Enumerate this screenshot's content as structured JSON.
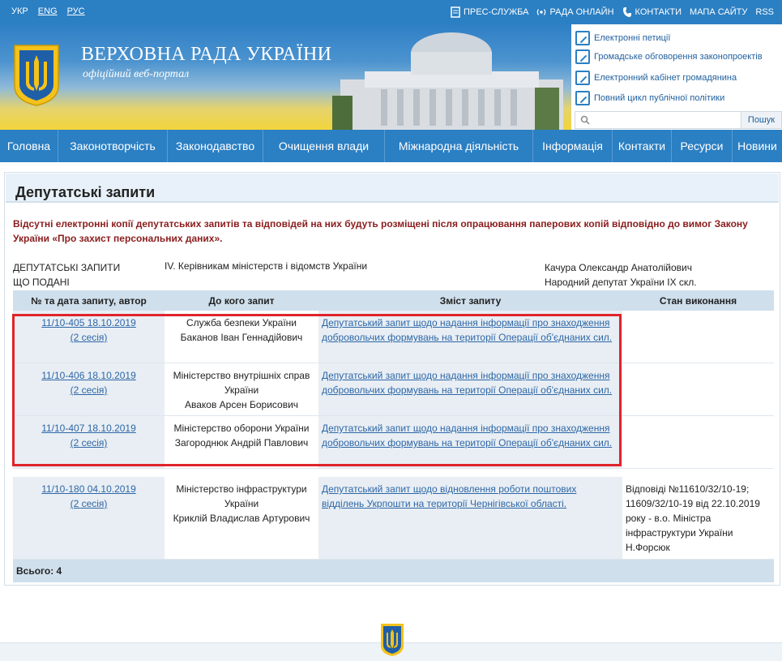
{
  "topbar": {
    "langs": [
      "УКР",
      "ENG",
      "РУС"
    ],
    "links": {
      "press": "ПРЕС-СЛУЖБА",
      "online": "РАДА ОНЛАЙН",
      "contacts": "КОНТАКТИ",
      "sitemap": "МАПА САЙТУ",
      "rss": "RSS"
    }
  },
  "header": {
    "title": "ВЕРХОВНА РАДА УКРАЇНИ",
    "subtitle": "офіційний веб-портал",
    "side_links": [
      "Електронні петиції",
      "Громадське обговорення законопроектів",
      "Електронний кабінет громадянина",
      "Повний цикл публічної політики"
    ],
    "search_button": "Пошук"
  },
  "nav": [
    "Головна",
    "Законотворчість",
    "Законодавство",
    "Очищення влади",
    "Міжнародна діяльність",
    "Інформація",
    "Контакти",
    "Ресурси",
    "Новини"
  ],
  "page": {
    "title": "Депутатські запити",
    "notice": "Відсутні електронні копії депутатських запитів та відповідей на них будуть розміщені після опрацювання паперових копій відповідно до вимог Закону України «Про захист персональних даних».",
    "meta_left_1": "ДЕПУТАТСЬКІ ЗАПИТИ",
    "meta_left_2": "ЩО ПОДАНІ",
    "meta_mid": "IV. Керівникам міністерств і відомств України",
    "meta_right_1": "Качура Олександр Анатолійович",
    "meta_right_2": "Народний депутат України IX скл."
  },
  "table": {
    "headers": [
      "№ та дата запиту, автор",
      "До кого запит",
      "Зміст запиту",
      "Стан виконання"
    ],
    "rows": [
      {
        "num": "11/10-405 18.10.2019",
        "session": "(2 сесія)",
        "to": [
          "Служба безпеки України",
          "Баканов Іван Геннадійович"
        ],
        "content": "Депутатський запит щодо надання інформації про знаходження добровольчих формувань на території Операції об'єднаних сил.",
        "status": ""
      },
      {
        "num": "11/10-406 18.10.2019",
        "session": "(2 сесія)",
        "to": [
          "Міністерство внутрішніх справ",
          "України",
          "Аваков Арсен Борисович"
        ],
        "content": "Депутатський запит щодо надання інформації про знаходження добровольчих формувань на території Операції об'єднаних сил.",
        "status": ""
      },
      {
        "num": "11/10-407 18.10.2019",
        "session": "(2 сесія)",
        "to": [
          "Міністерство оборони України",
          "Загороднюк Андрій Павлович"
        ],
        "content": "Депутатський запит щодо надання інформації про знаходження добровольчих формувань на території Операції об'єднаних сил.",
        "status": ""
      },
      {
        "num": "11/10-180 04.10.2019",
        "session": "(2 сесія)",
        "to": [
          "Міністерство інфраструктури",
          "України",
          "Криклій Владислав Артурович"
        ],
        "content": "Депутатський запит щодо відновлення роботи поштових відділень Укрпошти на території Чернігівської області.",
        "status": "Відповіді №11610/32/10-19; 11609/32/10-19 від 22.10.2019 року - в.о. Міністра інфраструктури України Н.Форсюк"
      }
    ],
    "total": "Всього: 4"
  }
}
